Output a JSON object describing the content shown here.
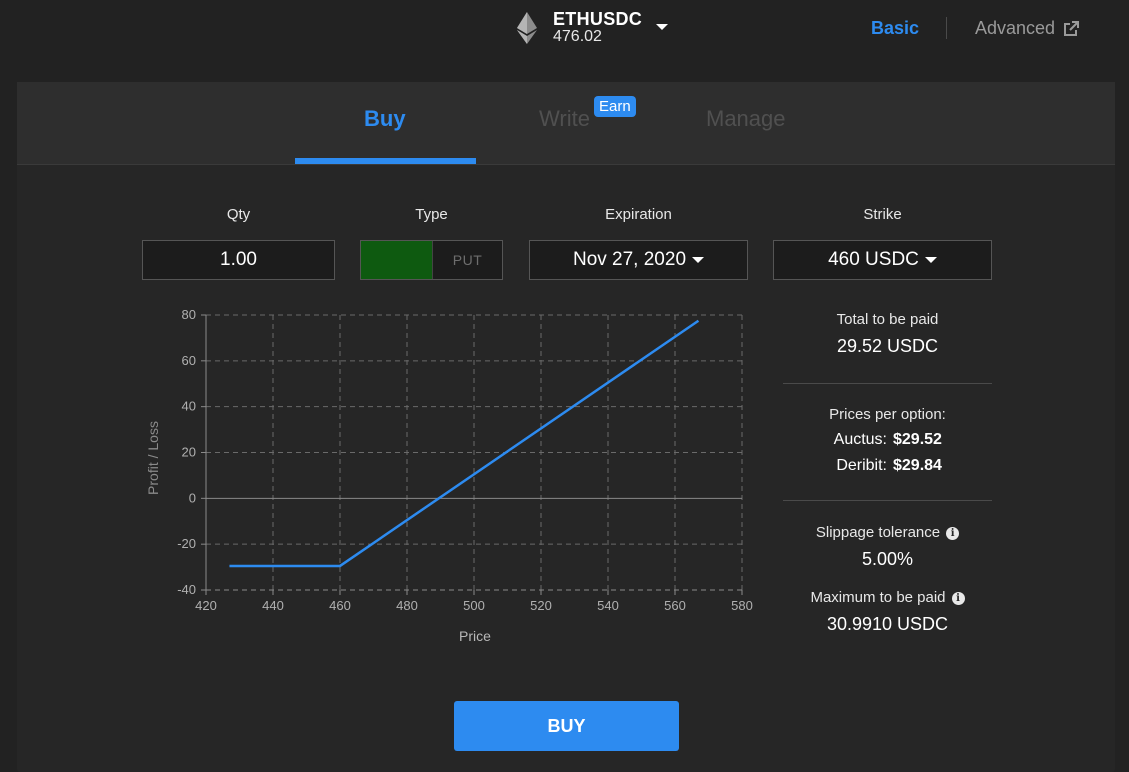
{
  "pair": {
    "symbol": "ETHUSDC",
    "price": "476.02",
    "icon": "ethereum-icon"
  },
  "mode": {
    "basic": "Basic",
    "advanced": "Advanced"
  },
  "tabs": {
    "buy": "Buy",
    "write": "Write",
    "earn_badge": "Earn",
    "manage": "Manage"
  },
  "form": {
    "qty_label": "Qty",
    "qty_value": "1.00",
    "type_label": "Type",
    "type_call": "",
    "type_put": "PUT",
    "expiration_label": "Expiration",
    "expiration_value": "Nov 27, 2020",
    "strike_label": "Strike",
    "strike_value": "460 USDC"
  },
  "summary": {
    "total_label": "Total to be paid",
    "total_value": "29.52 USDC",
    "prices_label": "Prices per option:",
    "auctus_label": "Auctus:",
    "auctus_value": "$29.52",
    "deribit_label": "Deribit:",
    "deribit_value": "$29.84",
    "slippage_label": "Slippage tolerance",
    "slippage_value": "5.00%",
    "max_label": "Maximum to be paid",
    "max_value": "30.9910 USDC"
  },
  "buy_button": "BUY",
  "colors": {
    "accent": "#2d8bf0",
    "call_green": "#0e5a10",
    "background": "#222222",
    "panel": "#262626"
  },
  "chart_data": {
    "type": "line",
    "xlabel": "Price",
    "ylabel": "Profit / Loss",
    "xlim": [
      420,
      580
    ],
    "ylim": [
      -40,
      80
    ],
    "x_ticks": [
      420,
      440,
      460,
      480,
      500,
      520,
      540,
      560,
      580
    ],
    "y_ticks": [
      -40,
      -20,
      0,
      20,
      40,
      60,
      80
    ],
    "grid": true,
    "series": [
      {
        "x": [
          427,
          460,
          567
        ],
        "y": [
          -29.5,
          -29.5,
          77.5
        ]
      }
    ]
  }
}
